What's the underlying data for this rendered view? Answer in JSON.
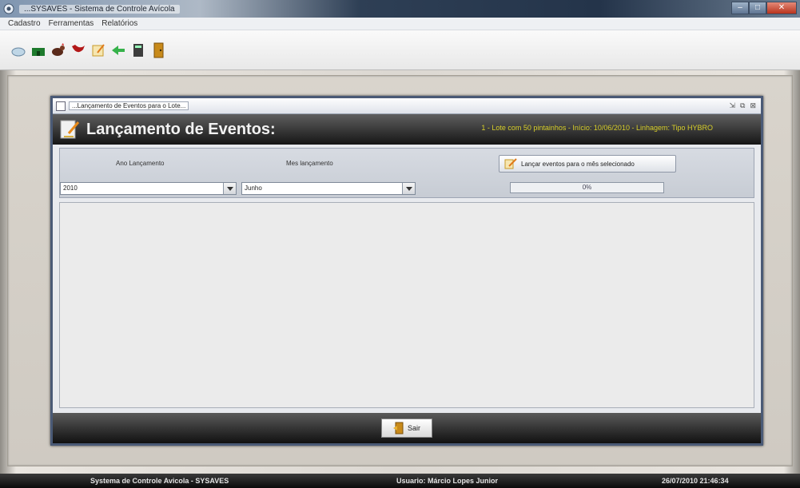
{
  "window": {
    "title": "...SYSAVES - Sistema de Controle Avícola"
  },
  "menu": [
    "Cadastro",
    "Ferramentas",
    "Relatórios"
  ],
  "toolbar": {
    "icons": [
      "cloud-icon",
      "barn-icon",
      "hen-icon",
      "rooster-icon",
      "note-icon",
      "arrow-icon",
      "calculator-icon",
      "exit-door-icon"
    ]
  },
  "frame": {
    "title": "...Lançamento de Eventos para o Lote...",
    "heading": "Lançamento de Eventos:",
    "lote_info": "1 - Lote com 50 pintainhos - Início: 10/06/2010 - Linhagem: Tipo HYBRO",
    "ano_label": "Ano Lançamento",
    "mes_label": "Mes lançamento",
    "ano_value": "2010",
    "mes_value": "Junho",
    "launch_button": "Lançar eventos para o mês selecionado",
    "progress_value": 0,
    "progress_text": "0%",
    "exit_button": "Sair"
  },
  "status": {
    "system": "Systema de Controle Avicola - SYSAVES",
    "user": "Usuario: Márcio Lopes Junior",
    "datetime": "26/07/2010 21:46:34"
  },
  "colors": {
    "banner_text": "#f2f2f2",
    "lote_info_text": "#d8cf2a",
    "frame_border": "#4a5a76"
  }
}
